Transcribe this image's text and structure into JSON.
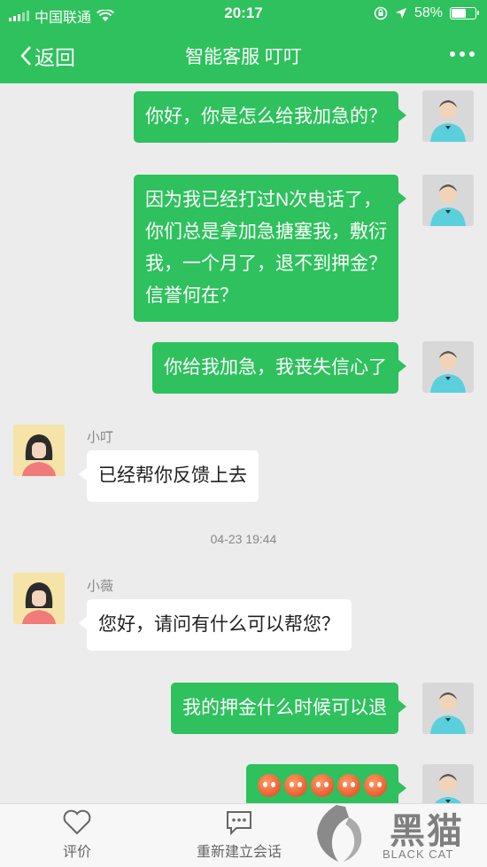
{
  "status_bar": {
    "carrier": "中国联通",
    "time": "20:17",
    "battery": "58%"
  },
  "nav": {
    "back_label": "返回",
    "title": "智能客服 叮叮"
  },
  "messages": {
    "m1": "你好，你是怎么给我加急的？",
    "m2": [
      "因为我已经打过N次电话了，",
      "你们总是拿加急搪塞我，敷衍",
      "我，一个月了，退不到押金？",
      "信誉何在？"
    ],
    "m3": "你给我加急，我丧失信心了",
    "m4_sender": "小叮",
    "m4": "已经帮你反馈上去",
    "timestamp": "04-23 19:44",
    "m5_sender": "小薇",
    "m5": "您好，请问有什么可以帮您？",
    "m6": "我的押金什么时候可以退",
    "m7_emoji_count": 5
  },
  "bottom_bar": {
    "rate_label": "评价",
    "restart_label": "重新建立会话"
  },
  "watermark": {
    "brand": "黑猫",
    "sub": "BLACK CAT"
  },
  "colors": {
    "accent": "#2ec15d",
    "background": "#ececec"
  }
}
